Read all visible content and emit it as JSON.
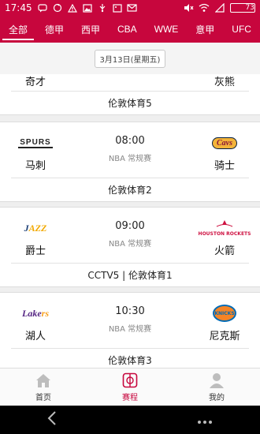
{
  "statusbar": {
    "time": "17:45",
    "battery": "73",
    "battery_level": 0.73
  },
  "tabs": [
    {
      "label": "全部",
      "active": true
    },
    {
      "label": "德甲"
    },
    {
      "label": "西甲"
    },
    {
      "label": "CBA"
    },
    {
      "label": "WWE"
    },
    {
      "label": "意甲"
    },
    {
      "label": "UFC"
    }
  ],
  "date": "3月13日(星期五)",
  "matches": [
    {
      "home": "奇才",
      "away": "灰熊",
      "channel": "伦敦体育5"
    },
    {
      "home": "马刺",
      "away": "骑士",
      "time": "08:00",
      "league": "NBA 常规赛",
      "channel": "伦敦体育2",
      "home_logo": "SPURS",
      "away_logo": "Cavs"
    },
    {
      "home": "爵士",
      "away": "火箭",
      "time": "09:00",
      "league": "NBA 常规赛",
      "channel": "CCTV5 | 伦敦体育1",
      "home_logo_a": "J",
      "home_logo_b": "AZZ",
      "away_logo": "HOUSTON ROCKETS"
    },
    {
      "home": "湖人",
      "away": "尼克斯",
      "time": "10:30",
      "league": "NBA 常规赛",
      "channel": "伦敦体育3",
      "home_logo_a": "Lake",
      "home_logo_b": "rs",
      "away_logo": "KNICKS"
    }
  ],
  "bottomnav": [
    {
      "label": "首页"
    },
    {
      "label": "赛程",
      "active": true
    },
    {
      "label": "我的"
    }
  ],
  "colors": {
    "accent": "#c7063d",
    "background": "#efefef"
  }
}
